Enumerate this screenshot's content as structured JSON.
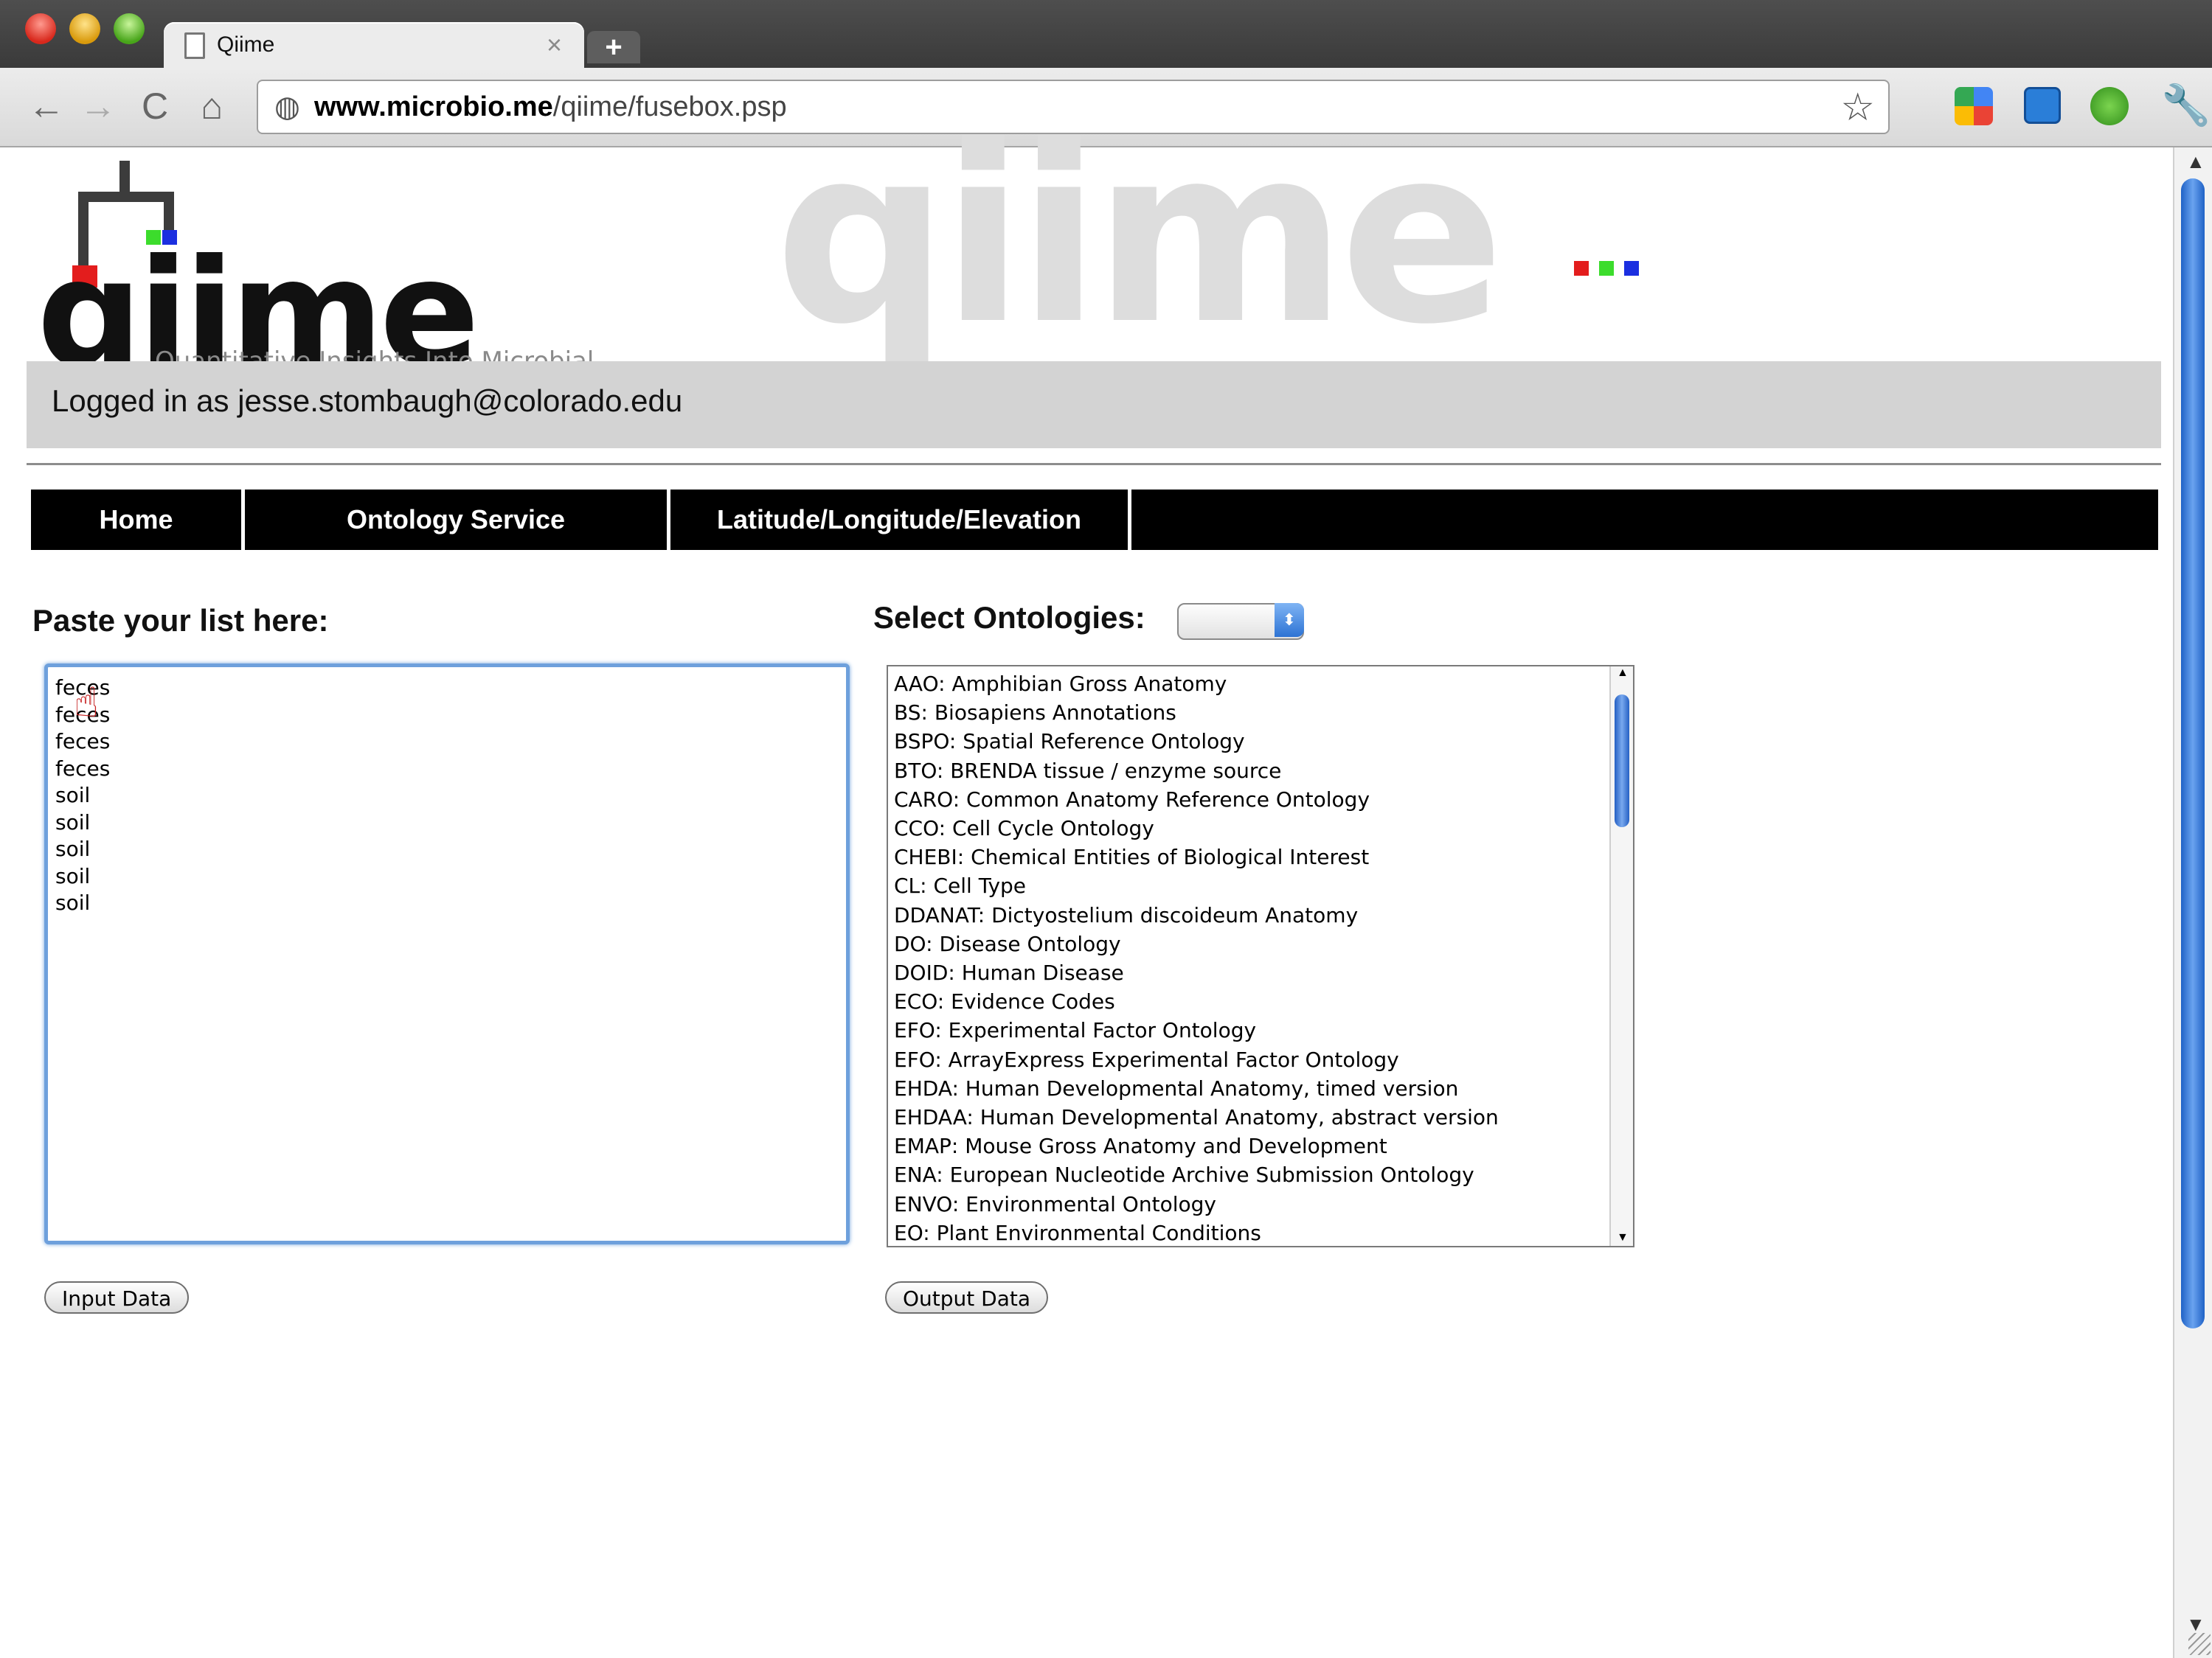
{
  "browser": {
    "tab_title": "Qiime",
    "tab_close": "×",
    "new_tab": "+",
    "url_host": "www.microbio.me",
    "url_path": "/qiime/fusebox.psp",
    "back": "←",
    "forward": "→",
    "reload": "C",
    "home": "⌂",
    "star": "☆",
    "wrench": "🔧"
  },
  "header": {
    "logo_text": "qiime",
    "tagline": "Quantitative Insights Into Microbial Ecology",
    "watermark": "qiime",
    "logged_in": "Logged in as jesse.stombaugh@colorado.edu",
    "logo_colors": [
      "#e31d1d",
      "#3cdc2c",
      "#1b2fe0"
    ]
  },
  "nav": {
    "items": [
      {
        "label": "Home"
      },
      {
        "label": "Ontology Service"
      },
      {
        "label": "Latitude/Longitude/Elevation"
      }
    ]
  },
  "left": {
    "heading": "Paste your list here:",
    "list_value": "feces\nfeces\nfeces\nfeces\nsoil\nsoil\nsoil\nsoil\nsoil",
    "button": "Input Data"
  },
  "right": {
    "heading": "Select Ontologies:",
    "select_caret": "⬍",
    "ontologies": [
      "AAO: Amphibian Gross Anatomy",
      "BS: Biosapiens Annotations",
      "BSPO: Spatial Reference Ontology",
      "BTO: BRENDA tissue / enzyme source",
      "CARO: Common Anatomy Reference Ontology",
      "CCO: Cell Cycle Ontology",
      "CHEBI: Chemical Entities of Biological Interest",
      "CL: Cell Type",
      "DDANAT: Dictyostelium discoideum Anatomy",
      "DO: Disease Ontology",
      "DOID: Human Disease",
      "ECO: Evidence Codes",
      "EFO: Experimental Factor Ontology",
      "EFO: ArrayExpress Experimental Factor Ontology",
      "EHDA: Human Developmental Anatomy, timed version",
      "EHDAA: Human Developmental Anatomy, abstract version",
      "EMAP: Mouse Gross Anatomy and Development",
      "ENA: European Nucleotide Archive Submission Ontology",
      "ENVO: Environmental Ontology",
      "EO: Plant Environmental Conditions"
    ],
    "button": "Output Data"
  }
}
